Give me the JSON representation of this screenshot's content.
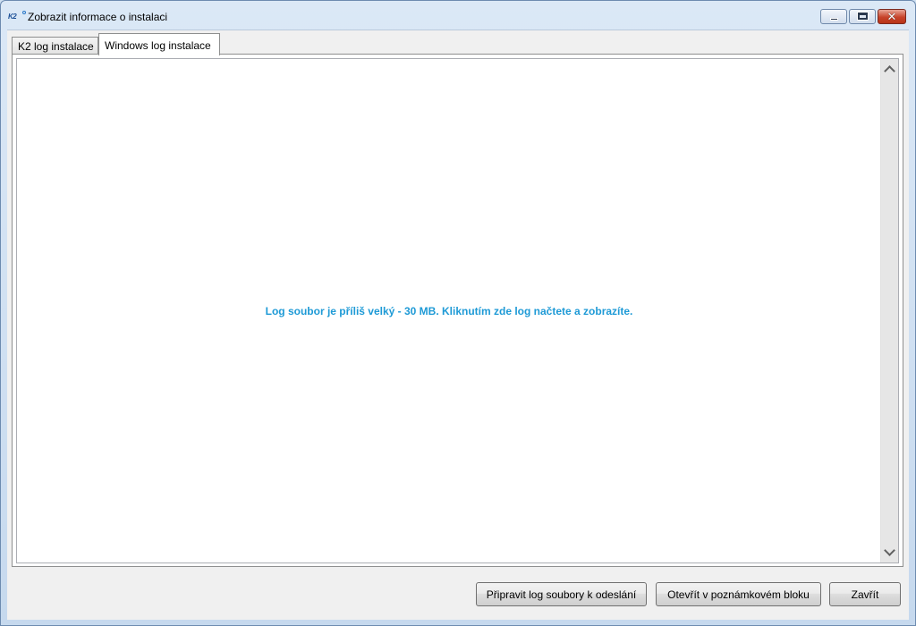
{
  "window": {
    "title": "Zobrazit informace o instalaci",
    "logo_text": "K2",
    "controls": {
      "minimize_icon": "minimize-icon",
      "maximize_icon": "maximize-icon",
      "close_icon": "close-icon",
      "close_glyph": "✕"
    }
  },
  "tabs": [
    {
      "label": "K2 log instalace",
      "active": false
    },
    {
      "label": "Windows log instalace",
      "active": true
    }
  ],
  "log": {
    "message": "Log soubor je příliš velký - 30 MB. Kliknutím zde log načtete a zobrazíte."
  },
  "buttons": {
    "prepare_label": "Připravit log soubory k odeslání",
    "open_notepad_label": "Otevřít v poznámkovém bloku",
    "close_label": "Zavřít"
  },
  "colors": {
    "link": "#1e9ad6",
    "close_button": "#c7432a"
  }
}
